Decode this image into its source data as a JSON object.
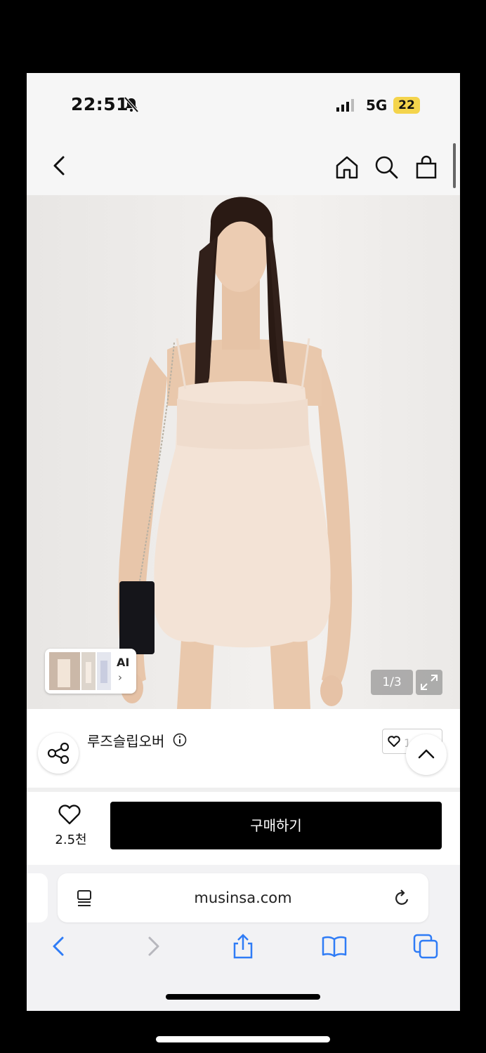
{
  "status": {
    "time": "22:51",
    "network": "5G",
    "battery": "22"
  },
  "product": {
    "image_counter": "1/3",
    "ai_label": "AI",
    "ai_chevron": "›",
    "name": "루즈슬립오버",
    "wish_chip_count": "1.1만"
  },
  "buy": {
    "like_count": "2.5천",
    "button_label": "구매하기"
  },
  "browser": {
    "url": "musinsa.com"
  },
  "colors": {
    "buy_button": "#000000",
    "safari_blue": "#2f7cf6",
    "battery": "#f4d44c"
  }
}
